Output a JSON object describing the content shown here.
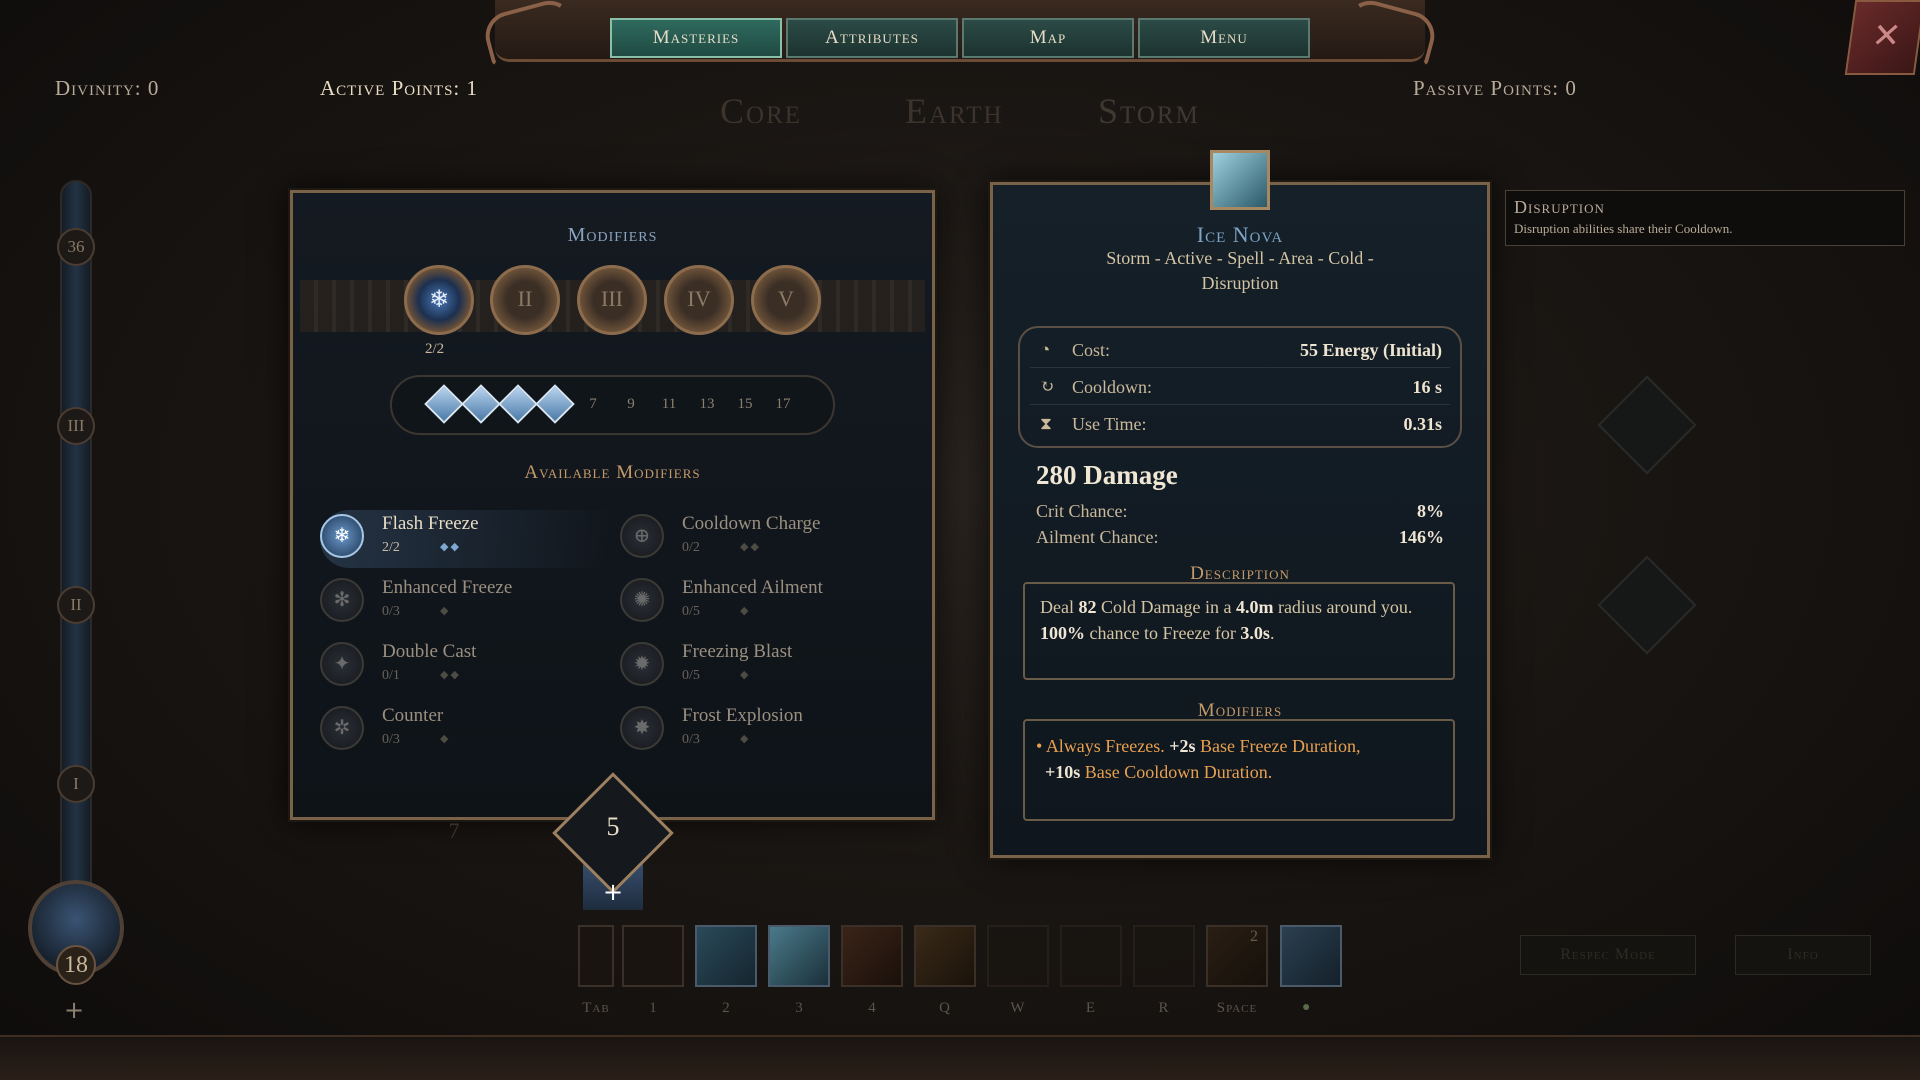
{
  "nav": {
    "tabs": [
      "Masteries",
      "Attributes",
      "Map",
      "Menu"
    ],
    "active": "Masteries"
  },
  "header": {
    "divinity": "Divinity: 0",
    "active_points": "Active Points: 1",
    "passive_points": "Passive Points: 0",
    "tree_tabs": [
      "Core",
      "Earth",
      "Storm"
    ]
  },
  "progress": {
    "tiers": [
      "36",
      "III",
      "II",
      "I"
    ],
    "level": "18",
    "plus": "+"
  },
  "modifiers_panel": {
    "title": "Modifiers",
    "slots": [
      "II",
      "III",
      "IV",
      "V"
    ],
    "slot_count": "2/2",
    "diamond_labels": [
      "7",
      "9",
      "11",
      "13",
      "15",
      "17"
    ],
    "filled_diamonds": 4,
    "available_title": "Available Modifiers",
    "items": [
      {
        "name": "Flash Freeze",
        "count": "2/2",
        "selected": true
      },
      {
        "name": "Cooldown Charge",
        "count": "0/2",
        "selected": false
      },
      {
        "name": "Enhanced Freeze",
        "count": "0/3",
        "selected": false
      },
      {
        "name": "Enhanced Ailment",
        "count": "0/5",
        "selected": false
      },
      {
        "name": "Double Cast",
        "count": "0/1",
        "selected": false
      },
      {
        "name": "Freezing Blast",
        "count": "0/5",
        "selected": false
      },
      {
        "name": "Counter",
        "count": "0/3",
        "selected": false
      },
      {
        "name": "Frost Explosion",
        "count": "0/3",
        "selected": false
      }
    ],
    "points": "5",
    "plus": "+",
    "behind_badge": "7"
  },
  "skill": {
    "name": "Ice Nova",
    "tags": "Storm - Active - Spell - Area - Cold -",
    "tags2": "Disruption",
    "cost_label": "Cost:",
    "cost_value": "55 Energy (Initial)",
    "cooldown_label": "Cooldown:",
    "cooldown_value": "16 s",
    "usetime_label": "Use Time:",
    "usetime_value": "0.31s",
    "damage": "280 Damage",
    "crit_label": "Crit Chance:",
    "crit_value": "8%",
    "ailment_label": "Ailment Chance:",
    "ailment_value": "146%",
    "description_title": "Description",
    "desc": {
      "p1": "Deal ",
      "v1": "82",
      "p2": " Cold Damage in a ",
      "v2": "4.0m",
      "p3": " radius around you.",
      "v3": "100%",
      "p4": " chance to Freeze for ",
      "v4": "3.0s",
      "p5": "."
    },
    "modifiers_title": "Modifiers",
    "mod": {
      "a": "Always Freezes.",
      "b": "+2s",
      "c": " Base Freeze Duration,",
      "d": "+10s",
      "e": " Base Cooldown Duration."
    }
  },
  "tooltip": {
    "title": "Disruption",
    "text": "Disruption abilities share their Cooldown."
  },
  "hotbar": {
    "keys": [
      "Tab",
      "1",
      "2",
      "3",
      "4",
      "Q",
      "W",
      "E",
      "R",
      "Space"
    ],
    "count_badge": "2"
  },
  "dim_buttons": [
    "Respec Mode",
    "Info"
  ],
  "colors": {
    "accent_teal": "#2f6a5e",
    "gold": "#c59a6a",
    "highlight": "#e8a050"
  }
}
